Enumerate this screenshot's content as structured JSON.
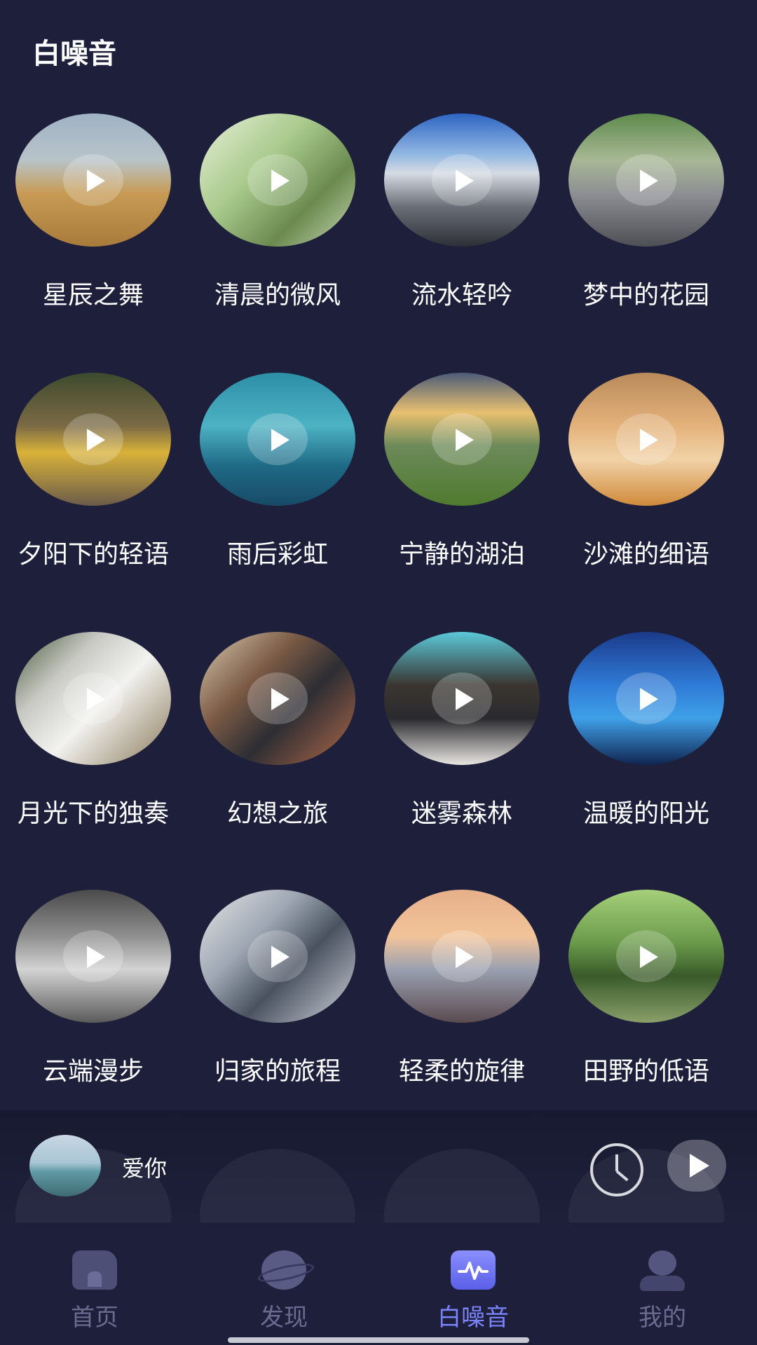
{
  "page_title": "白噪音",
  "cards": [
    {
      "title": "星辰之舞",
      "bg": "linear-gradient(180deg,#9fb3c6 0%,#b8c3c9 35%,#c79b54 60%,#a97b3b 100%)"
    },
    {
      "title": "清晨的微风",
      "bg": "linear-gradient(135deg,#e9f0d8 0%,#a8c98c 40%,#6b8a4f 70%,#c7d6b3 100%)"
    },
    {
      "title": "流水轻吟",
      "bg": "linear-gradient(180deg,#2d64c2 0%,#8fb6e2 30%,#d6dbe3 45%,#6a6f78 70%,#2d2f36 100%)"
    },
    {
      "title": "梦中的花园",
      "bg": "linear-gradient(180deg,#5e8a4c 0%,#a8b895 35%,#8d8f93 60%,#4d4f55 100%)"
    },
    {
      "title": "夕阳下的轻语",
      "bg": "linear-gradient(180deg,#3d4a2d 0%,#7b6a45 40%,#d9b23a 60%,#6b5b49 100%)"
    },
    {
      "title": "雨后彩虹",
      "bg": "linear-gradient(180deg,#2d8ea6 0%,#4db2c4 40%,#1f6a86 70%,#164a66 100%)"
    },
    {
      "title": "宁静的湖泊",
      "bg": "linear-gradient(180deg,#4b5b78 0%,#e8c070 30%,#6d8a5a 55%,#4f7a2e 100%)"
    },
    {
      "title": "沙滩的细语",
      "bg": "linear-gradient(180deg,#b98a5a 0%,#e4b27b 40%,#f1d2a7 65%,#d08a3b 100%)"
    },
    {
      "title": "月光下的独奏",
      "bg": "linear-gradient(135deg,#4a5a3a 0%,#c9c9c4 30%,#f2f2f0 55%,#8a7a5a 100%)"
    },
    {
      "title": "幻想之旅",
      "bg": "linear-gradient(135deg,#d9c9b0 0%,#7a5a45 35%,#2d2d33 60%,#b36a4a 100%)"
    },
    {
      "title": "迷雾森林",
      "bg": "linear-gradient(180deg,#5ac9d9 0%,#3a3530 40%,#2a2a2e 65%,#e9e6e2 100%)"
    },
    {
      "title": "温暖的阳光",
      "bg": "linear-gradient(180deg,#1a3a8a 0%,#2f7bd6 40%,#3fa0e8 65%,#102550 100%)"
    },
    {
      "title": "云端漫步",
      "bg": "linear-gradient(180deg,#4a4a4a 0%,#8f8f8f 35%,#d3d3d3 60%,#5a5a5a 100%)"
    },
    {
      "title": "归家的旅程",
      "bg": "linear-gradient(135deg,#e6e6e6 0%,#9ea7b3 35%,#4a5260 60%,#cfd4db 100%)"
    },
    {
      "title": "轻柔的旋律",
      "bg": "linear-gradient(180deg,#e6b08a 0%,#f2c49a 35%,#9aa0b0 60%,#5a4a50 100%)"
    },
    {
      "title": "田野的低语",
      "bg": "linear-gradient(180deg,#a6d07a 0%,#6a9a4a 40%,#3a5a2a 65%,#8aa06a 100%)"
    }
  ],
  "player": {
    "title": "爱你"
  },
  "tabs": [
    {
      "label": "首页"
    },
    {
      "label": "发现"
    },
    {
      "label": "白噪音"
    },
    {
      "label": "我的"
    }
  ],
  "colors": {
    "background": "#1d1f3b",
    "accent": "#7b83ff",
    "inactive_tab": "#6a6b8e"
  }
}
